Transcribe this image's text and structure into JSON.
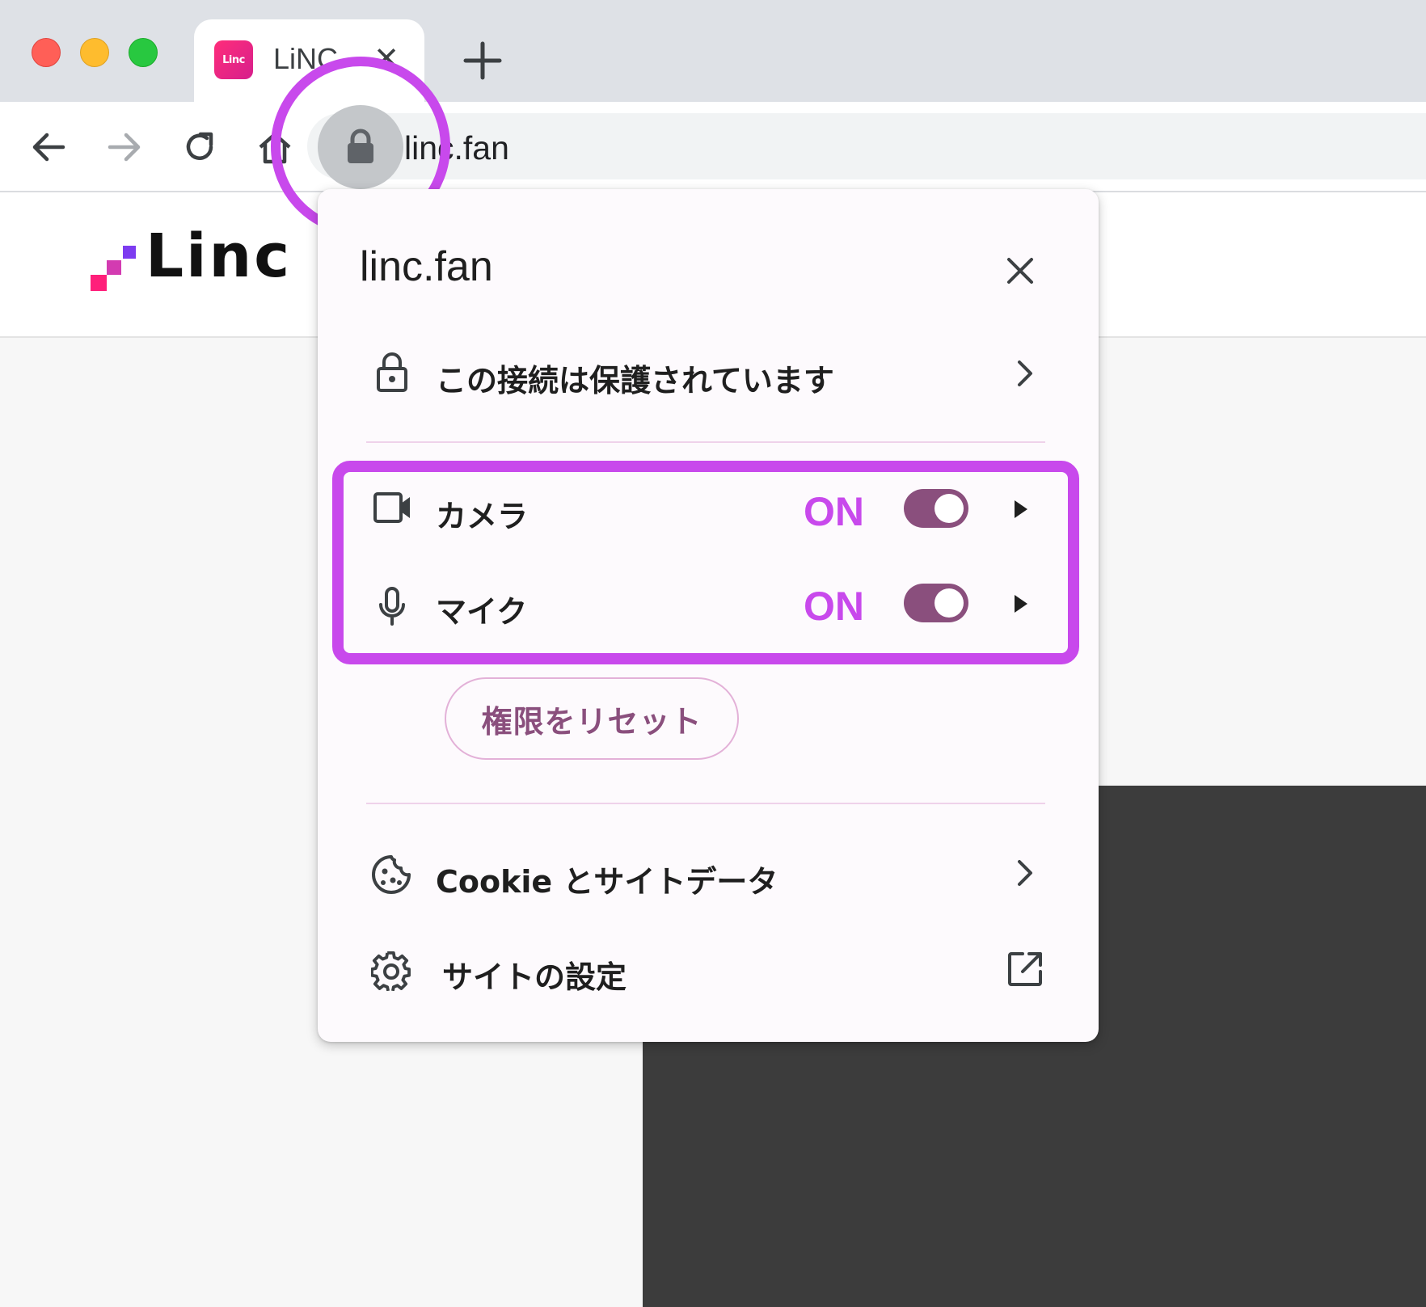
{
  "browser": {
    "tab": {
      "favicon_text": "Linc",
      "title": "LiNC"
    },
    "url": "linc.fan"
  },
  "page": {
    "brand": "Linc"
  },
  "popup": {
    "title": "linc.fan",
    "connection_label": "この接続は保護されています",
    "permissions": [
      {
        "label": "カメラ",
        "status": "ON",
        "enabled": true,
        "icon": "video-camera-icon"
      },
      {
        "label": "マイク",
        "status": "ON",
        "enabled": true,
        "icon": "microphone-icon"
      }
    ],
    "reset_button": "権限をリセット",
    "cookie_label": "Cookie とサイトデータ",
    "site_settings_label": "サイトの設定"
  },
  "colors": {
    "highlight": "#c849ec",
    "toggle_on": "#8a4f7d",
    "popup_bg": "#fdfafd",
    "divider": "#efd2ea"
  }
}
